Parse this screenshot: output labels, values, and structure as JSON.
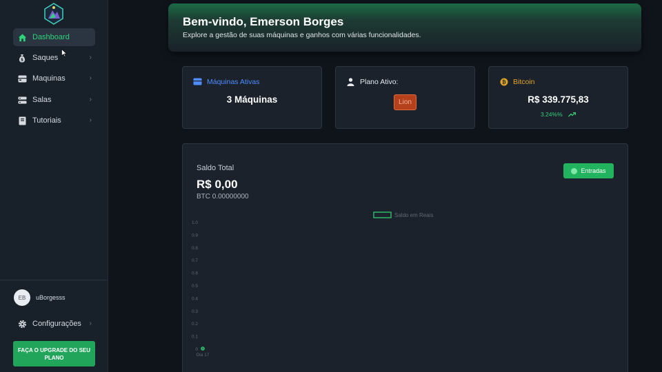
{
  "sidebar": {
    "items": [
      {
        "label": "Dashboard",
        "icon": "home-icon",
        "active": true
      },
      {
        "label": "Saques",
        "icon": "money-bag-icon"
      },
      {
        "label": "Maquinas",
        "icon": "server-icon"
      },
      {
        "label": "Salas",
        "icon": "list-icon"
      },
      {
        "label": "Tutoriais",
        "icon": "book-icon"
      }
    ],
    "user": {
      "initials": "EB",
      "name": "uBorgesss"
    },
    "settings_label": "Configurações",
    "upgrade_label": "FAÇA O UPGRADE DO SEU PLANO"
  },
  "banner": {
    "title": "Bem-vindo, Emerson Borges",
    "subtitle": "Explore a gestão de suas máquinas e ganhos com várias funcionalidades."
  },
  "cards": {
    "machines": {
      "label": "Máquinas Ativas",
      "value": "3 Máquinas"
    },
    "plan": {
      "label": "Plano Ativo:",
      "value": "Lion"
    },
    "bitcoin": {
      "label": "Bitcoin",
      "value": "R$ 339.775,83",
      "change": "3.24%%"
    }
  },
  "balance": {
    "label": "Saldo Total",
    "value": "R$ 0,00",
    "btc": "BTC 0.00000000",
    "button": "Entradas"
  },
  "colors": {
    "accent": "#2fd37a",
    "brand_green": "#22b35e",
    "bitcoin": "#e0a526",
    "machines": "#4f8cff"
  },
  "chart_data": {
    "type": "line",
    "series": [
      {
        "name": "Saldo em Reais",
        "values": [
          0
        ]
      }
    ],
    "categories": [
      "Dia 17"
    ],
    "ylim": [
      0,
      1.0
    ],
    "yticks": [
      "1.0",
      "0.9",
      "0.8",
      "0.7",
      "0.6",
      "0.5",
      "0.4",
      "0.3",
      "0.2",
      "0.1",
      "0"
    ],
    "legend": "top-center",
    "grid": false
  }
}
